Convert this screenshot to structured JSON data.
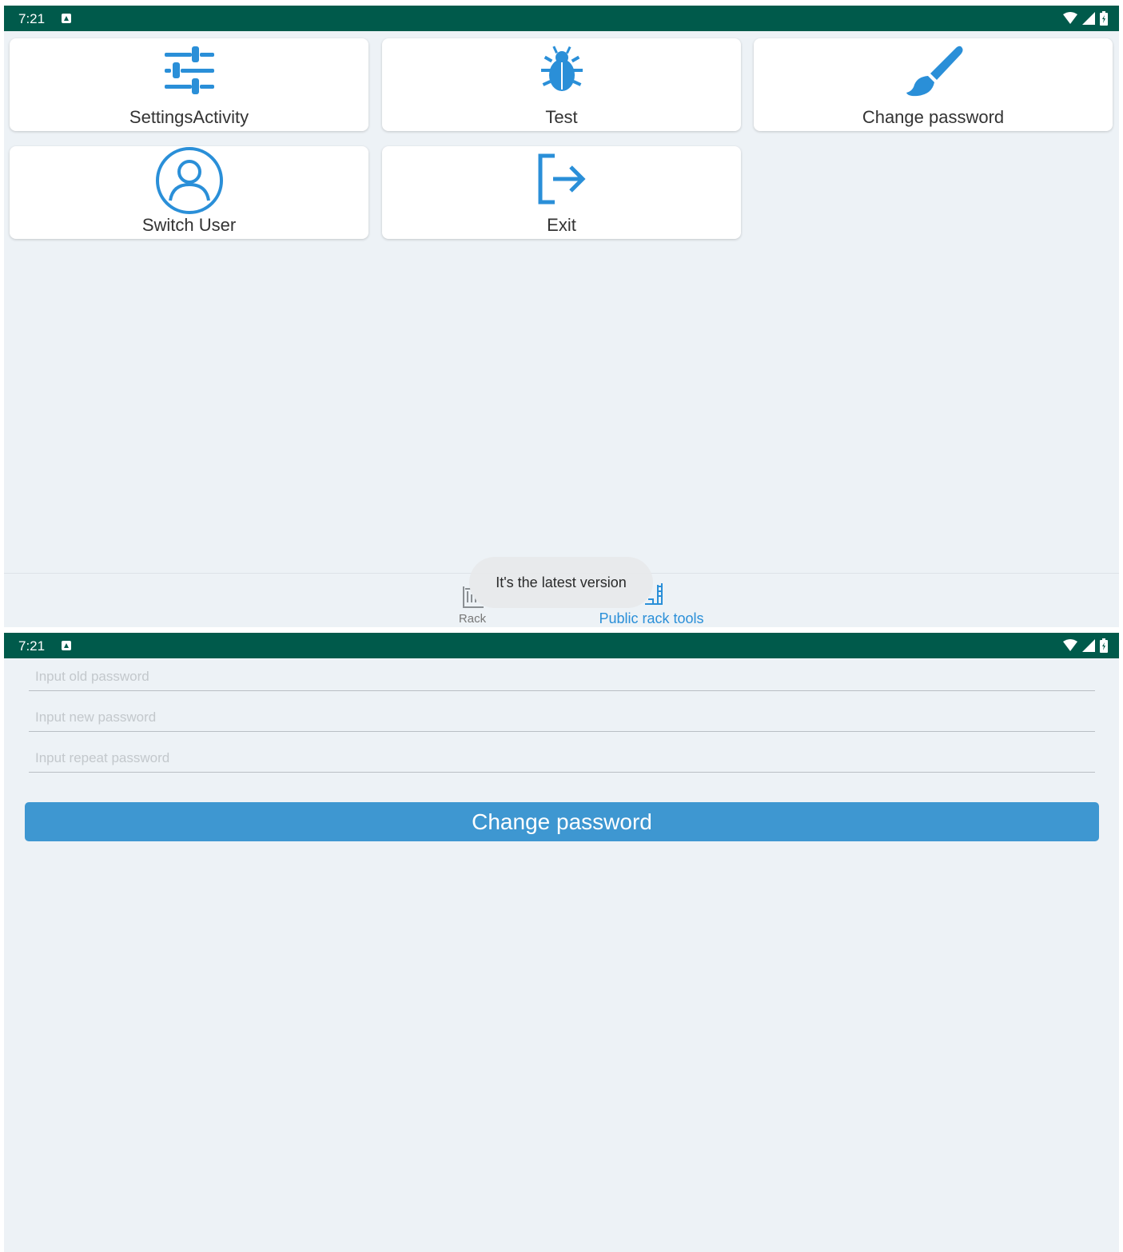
{
  "status_bar": {
    "time": "7:21",
    "icons": [
      "notification-a-icon",
      "wifi-icon",
      "cellular-icon",
      "battery-icon"
    ]
  },
  "menu": {
    "tiles": [
      {
        "label": "SettingsActivity",
        "icon": "sliders-icon"
      },
      {
        "label": "Test",
        "icon": "bug-icon"
      },
      {
        "label": "Change password",
        "icon": "paintbrush-icon"
      },
      {
        "label": "Switch User",
        "icon": "user-circle-icon"
      },
      {
        "label": "Exit",
        "icon": "exit-icon"
      }
    ]
  },
  "toast": {
    "text": "It's the latest version"
  },
  "bottom_nav": {
    "items": [
      {
        "label": "Rack",
        "icon": "rack-icon",
        "active": false
      },
      {
        "label": "Public rack tools",
        "icon": "public-rack-icon",
        "active": true
      }
    ]
  },
  "change_password": {
    "old_placeholder": "Input old password",
    "new_placeholder": "Input new password",
    "repeat_placeholder": "Input repeat password",
    "button_label": "Change password"
  },
  "colors": {
    "status_bar": "#005a4b",
    "accent": "#2a8fd8",
    "button": "#3e97d1",
    "background": "#edf2f6"
  }
}
